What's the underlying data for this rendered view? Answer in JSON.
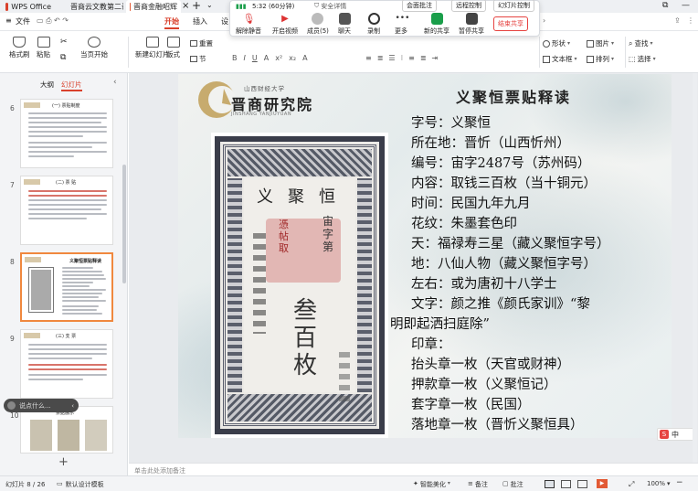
{
  "titlebar": {
    "app_tab": "WPS Office",
    "doc_tab1": "晋商云文教第二课: 晋商金融昭辉",
    "doc_tab2": "晋商金融昭辉"
  },
  "menubar": {
    "file": "文件",
    "tabs": [
      "开始",
      "插入",
      "设"
    ]
  },
  "meeting": {
    "timer": "5:32 (60分钟)",
    "security": "安全详情",
    "top_buttons": [
      "会面批注",
      "远程控制",
      "结束共享"
    ],
    "button_labels": [
      "解除静音",
      "开启视频",
      "成员(5)",
      "聊天",
      "录制",
      "更多",
      "新的共享",
      "暂停共享"
    ],
    "end_share": "结束共享",
    "remote_short": "远程控制",
    "record_short": "幻灯片控制"
  },
  "ribbon": {
    "format_brush": "格式刷",
    "paste": "粘贴",
    "from_current": "当页开始",
    "new_slide": "新建幻灯片",
    "layout": "版式",
    "reset": "重置",
    "section": "节",
    "shape": "形状",
    "picture": "图片",
    "textbox": "文本框",
    "arrange": "排列",
    "find": "查找",
    "select": "选择"
  },
  "sidebar": {
    "tab_outline": "大纲",
    "tab_slides": "幻灯片",
    "thumbs": [
      {
        "num": "6",
        "heading": "(一) 票贴制度"
      },
      {
        "num": "7",
        "heading": "(二) 票 贴"
      },
      {
        "num": "8",
        "heading": "义聚恒票贴释读"
      },
      {
        "num": "9",
        "heading": "(三) 支 票"
      },
      {
        "num": "10",
        "heading": "票据展示"
      }
    ],
    "pill_text": "说点什么...",
    "add": "+"
  },
  "slide": {
    "seal_small": "山西财经大学",
    "seal_main": "晋商研究院",
    "seal_sub": "JINSHANG YANJIUYUAN",
    "title": "义聚恒票贴释读",
    "lines": [
      "字号：义聚恒",
      "所在地：晋忻（山西忻州）",
      "编号：宙字2487号（苏州码）",
      "内容：取钱三百枚（当十铜元）",
      "时间：民国九年九月",
      "花纹：朱墨套色印",
      "天：福禄寿三星（藏义聚恒字号）",
      "地：八仙人物（藏义聚恒字号）",
      "左右：或为唐初十八学士",
      "文字：颜之推《颜氏家训》“黎",
      "明即起洒扫庭除”",
      "印章：",
      "抬头章一枚（天官或财神）",
      "押款章一枚（义聚恒记）",
      "套字章一枚（民国）",
      "落地章一枚（晋忻义聚恒具）"
    ],
    "note_chars": [
      "义",
      "聚",
      "恒",
      "宙",
      "字",
      "第",
      "叁",
      "百",
      "枚",
      "憑",
      "帖",
      "取"
    ]
  },
  "notes_placeholder": "单击此处添加备注",
  "status": {
    "slide_count": "幻灯片 8 / 26",
    "template": "默认设计模板",
    "beautify": "智能美化",
    "notes": "备注",
    "comments": "批注",
    "zoom": "100%"
  },
  "ime": {
    "label": "中"
  },
  "colors": {
    "accent": "#f0883e",
    "wps_red": "#d9412c",
    "end_share": "#e64340"
  }
}
